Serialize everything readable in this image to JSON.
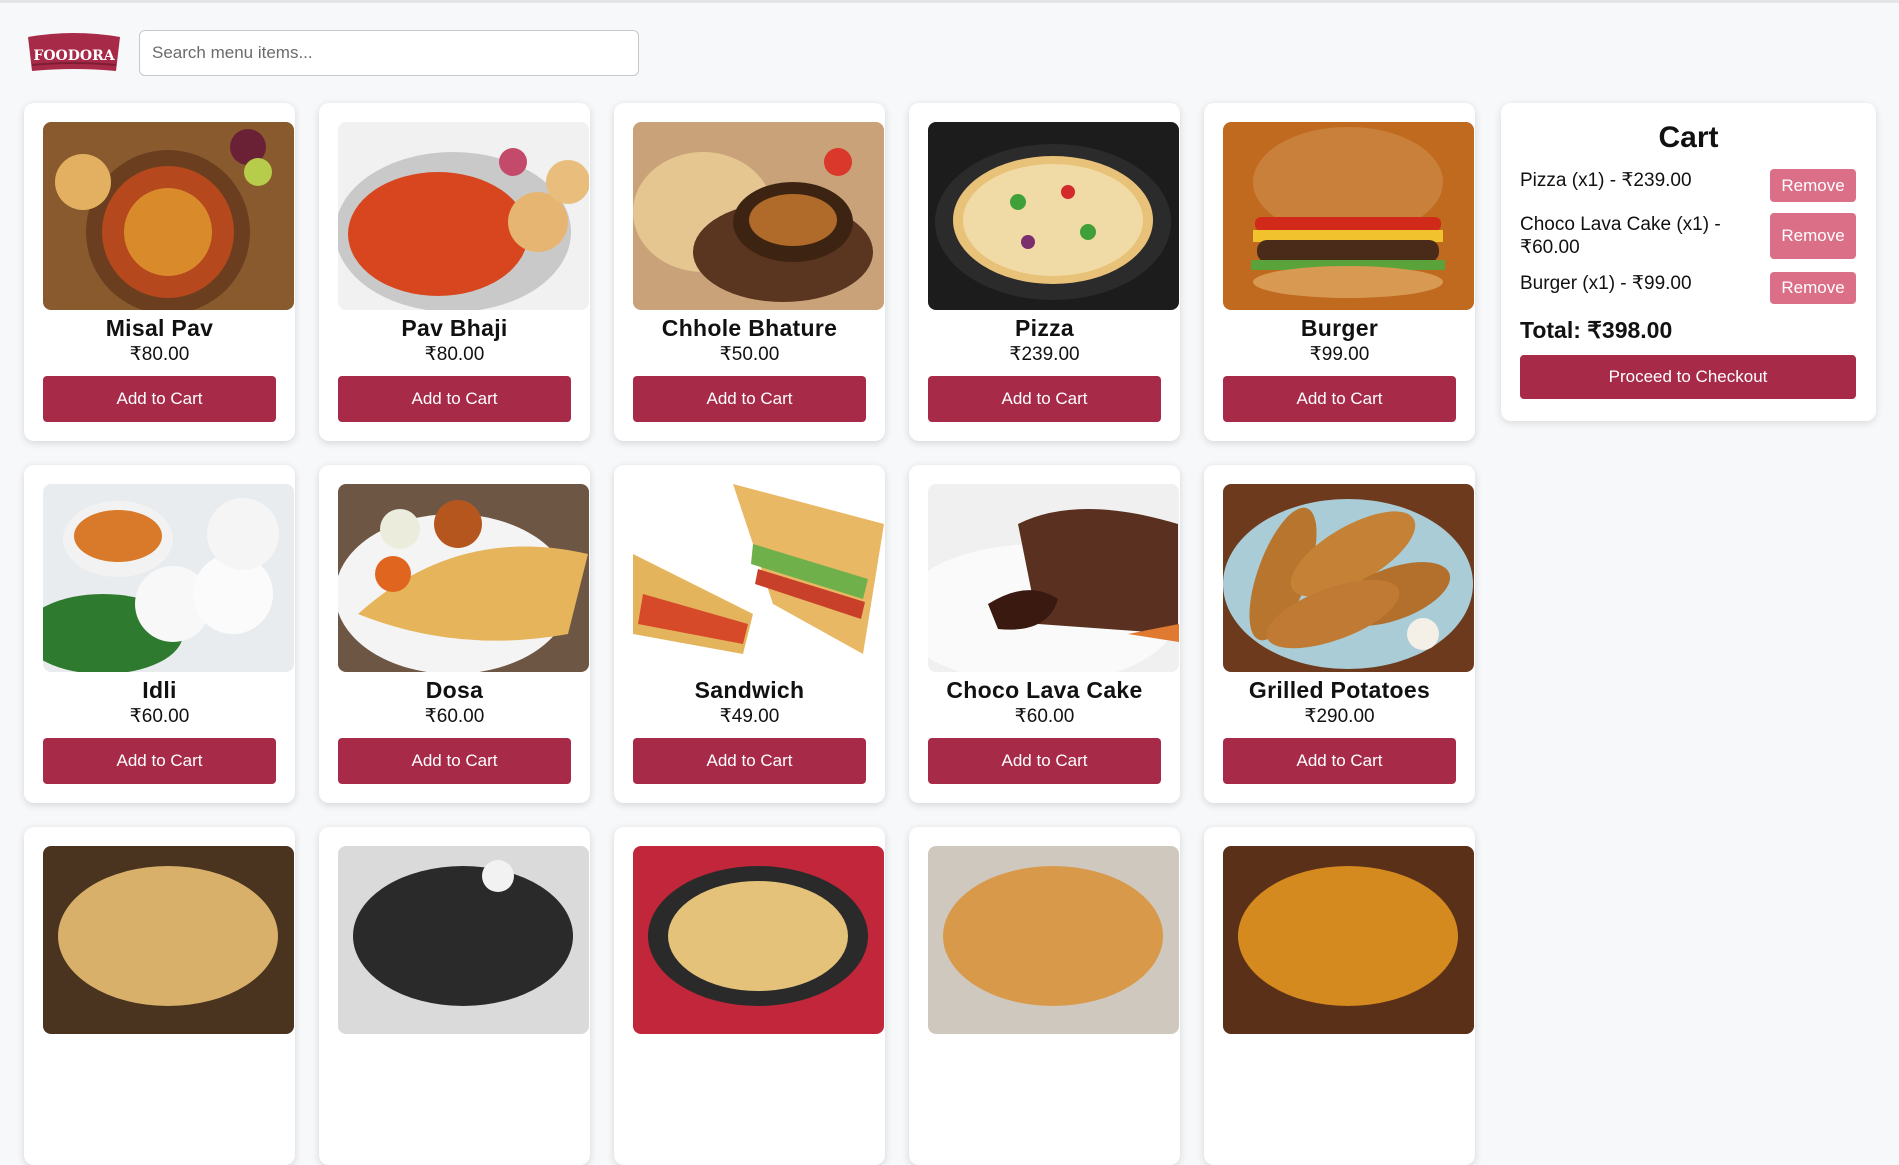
{
  "brand": {
    "logo_text": "FOODORA",
    "accent": "#a82a49",
    "remove_color": "#dc6f88"
  },
  "search": {
    "placeholder": "Search menu items...",
    "value": ""
  },
  "menu": [
    {
      "name": "Misal Pav",
      "price": "₹80.00",
      "add_label": "Add to Cart"
    },
    {
      "name": "Pav Bhaji",
      "price": "₹80.00",
      "add_label": "Add to Cart"
    },
    {
      "name": "Chhole Bhature",
      "price": "₹50.00",
      "add_label": "Add to Cart"
    },
    {
      "name": "Pizza",
      "price": "₹239.00",
      "add_label": "Add to Cart"
    },
    {
      "name": "Burger",
      "price": "₹99.00",
      "add_label": "Add to Cart"
    },
    {
      "name": "Idli",
      "price": "₹60.00",
      "add_label": "Add to Cart"
    },
    {
      "name": "Dosa",
      "price": "₹60.00",
      "add_label": "Add to Cart"
    },
    {
      "name": "Sandwich",
      "price": "₹49.00",
      "add_label": "Add to Cart"
    },
    {
      "name": "Choco Lava Cake",
      "price": "₹60.00",
      "add_label": "Add to Cart"
    },
    {
      "name": "Grilled Potatoes",
      "price": "₹290.00",
      "add_label": "Add to Cart"
    }
  ],
  "cart": {
    "title": "Cart",
    "items": [
      {
        "line1": "Pizza (x1) - ₹239.00",
        "line2": "",
        "remove_label": "Remove"
      },
      {
        "line1": "Choco Lava Cake (x1) -",
        "line2": "₹60.00",
        "remove_label": "Remove"
      },
      {
        "line1": "Burger (x1) - ₹99.00",
        "line2": "",
        "remove_label": "Remove"
      }
    ],
    "total": "Total: ₹398.00",
    "checkout_label": "Proceed to Checkout"
  }
}
